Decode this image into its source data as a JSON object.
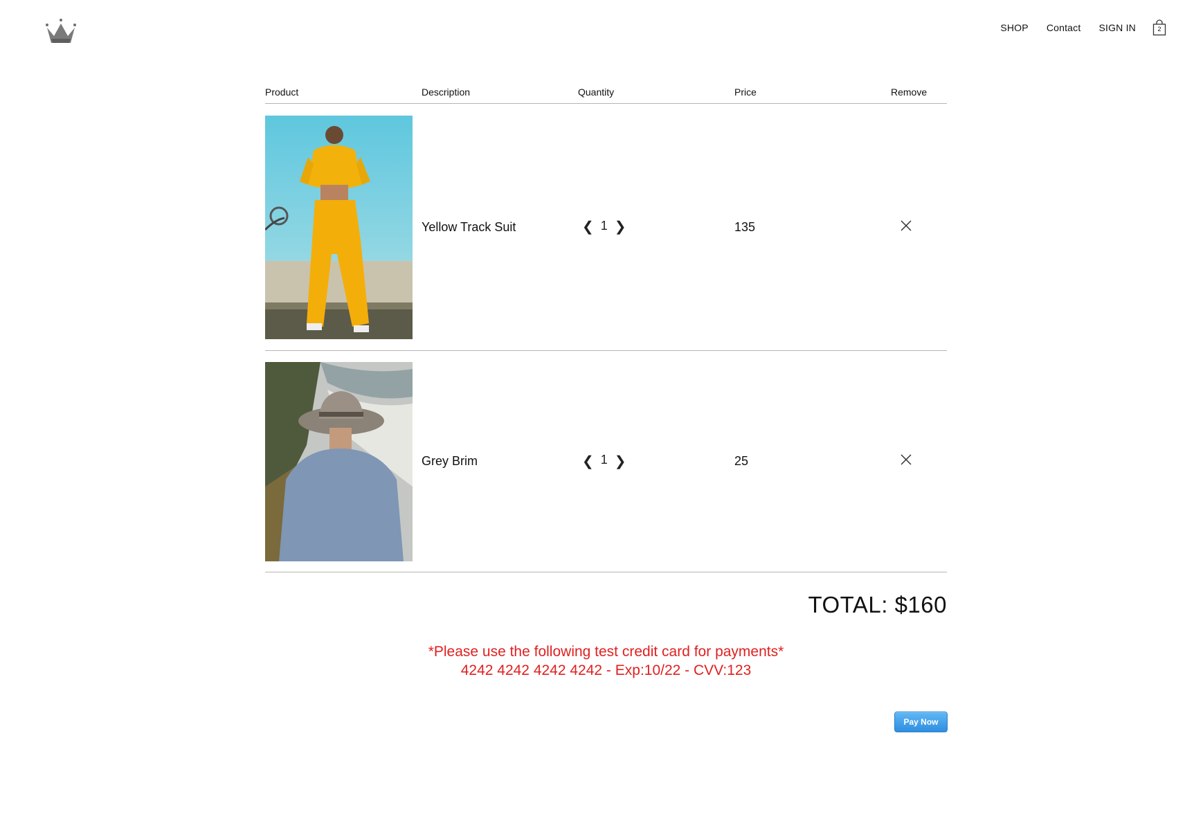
{
  "header": {
    "nav": [
      "SHOP",
      "Contact",
      "SIGN IN"
    ],
    "cart_count": "2"
  },
  "table": {
    "columns": [
      "Product",
      "Description",
      "Quantity",
      "Price",
      "Remove"
    ],
    "items": [
      {
        "description": "Yellow Track Suit",
        "quantity": "1",
        "price": "135"
      },
      {
        "description": "Grey Brim",
        "quantity": "1",
        "price": "25"
      }
    ]
  },
  "total": "TOTAL: $160",
  "notice": {
    "line1": "*Please use the following test credit card for payments*",
    "line2": "4242 4242 4242 4242 - Exp:10/22 - CVV:123"
  },
  "pay_button": "Pay Now",
  "colors": {
    "notice": "#e02020",
    "pay_button": "#3b9be6",
    "divider": "#b5b5b5"
  }
}
